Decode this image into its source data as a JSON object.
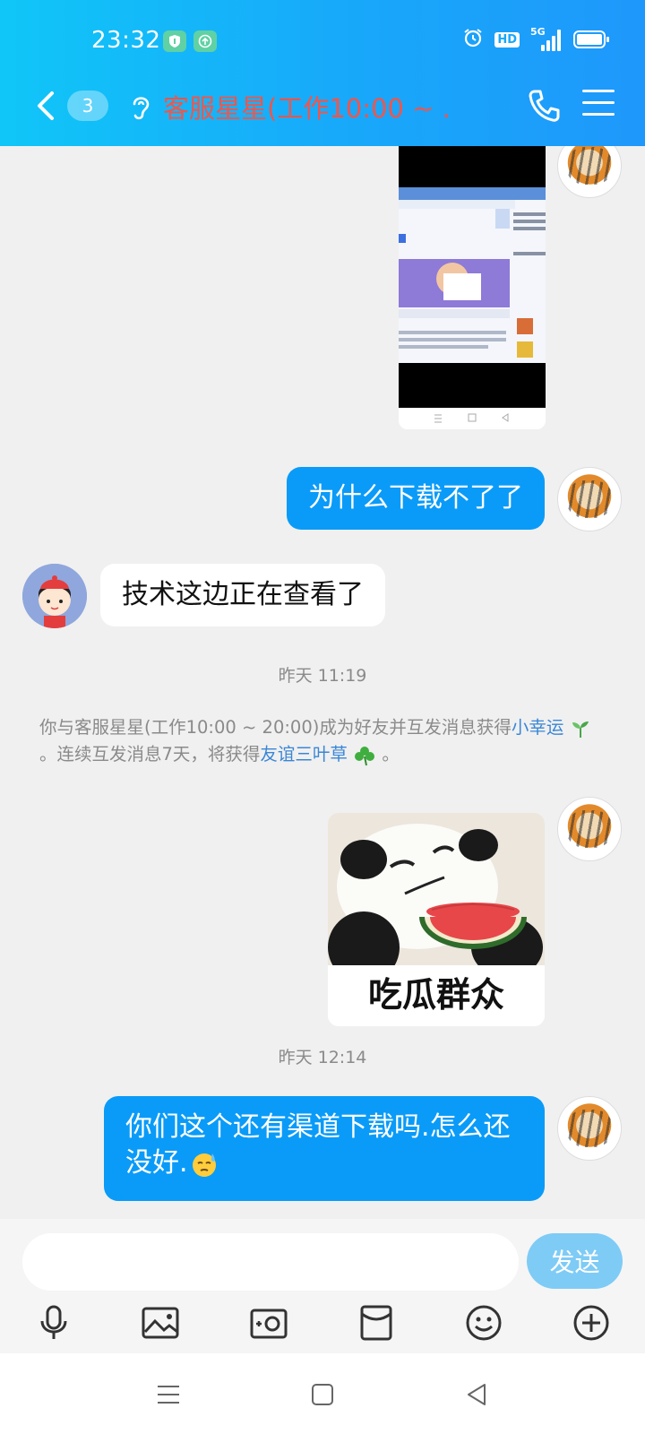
{
  "status": {
    "time": "23:32",
    "hd": "HD",
    "network": "5G"
  },
  "header": {
    "unread_count": "3",
    "title": "客服星星(工作10:00 ~ ...",
    "accent": "#f2554a"
  },
  "messages": {
    "m1": "为什么下载不了了",
    "m2": "技术这边正在查看了",
    "ts1": "昨天 11:19",
    "sys_part1": "你与客服星星(工作10:00 ~ 20:00)成为好友并互发消息获得",
    "sys_link1": "小幸运",
    "sys_part2": "。连续互发消息7天，将获得",
    "sys_link2": "友谊三叶草",
    "sys_part3": "。",
    "sticker_caption": "吃瓜群众",
    "ts2": "昨天 12:14",
    "m3": "你们这个还有渠道下载吗.怎么还没好."
  },
  "input": {
    "placeholder": "",
    "send_label": "发送"
  },
  "colors": {
    "bubble_me": "#0a9bf8",
    "header_gradient_start": "#10c6f8",
    "header_gradient_end": "#1e98fb",
    "link": "#3a86d6"
  }
}
